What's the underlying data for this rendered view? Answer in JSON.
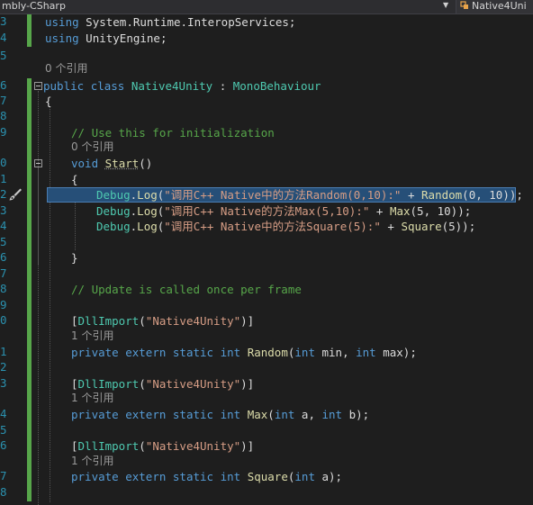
{
  "topbar": {
    "project_label": "mbly-CSharp",
    "class_label": "Native4Uni"
  },
  "line_numbers": [
    "3",
    "4",
    "5",
    "6",
    "7",
    "8",
    "9",
    "0",
    "1",
    "2",
    "3",
    "4",
    "5",
    "6",
    "7",
    "8",
    "9",
    "0",
    "1",
    "2",
    "3",
    "4",
    "5",
    "6",
    "7",
    "8"
  ],
  "code": {
    "using1_kw": "using",
    "using1_ns": " System.Runtime.InteropServices;",
    "using2_kw": "using",
    "using2_ns": " UnityEngine;",
    "lens_class": "0 个引用",
    "class_kw1": "public",
    "class_kw2": "class",
    "class_name": "Native4Unity",
    "class_colon": " : ",
    "class_base": "MonoBehaviour",
    "brace_open": "{",
    "comment_init": "// Use this for initialization",
    "lens_start": "0 个引用",
    "start_kw": "void",
    "start_name": "Start",
    "start_parens": "()",
    "start_brace": "{",
    "log1_obj": "Debug",
    "log1_dot": ".",
    "log1_m": "Log",
    "log1_open": "(",
    "log1_str": "\"调用C++ Native中的方法Random(0,10):\"",
    "log1_plus": " + ",
    "log1_call": "Random",
    "log1_args": "(0, 10));",
    "log2_obj": "Debug",
    "log2_m": "Log",
    "log2_str": "\"调用C++ Native的方法Max(5,10):\"",
    "log2_call": "Max",
    "log2_args": "(5, 10));",
    "log3_obj": "Debug",
    "log3_m": "Log",
    "log3_str": "\"调用C++ Native中的方法Square(5):\"",
    "log3_call": "Square",
    "log3_args": "(5));",
    "start_brace_close": "}",
    "comment_update": "// Update is called once per frame",
    "attr_open": "[",
    "attr_name": "DllImport",
    "attr_str": "\"Native4Unity\"",
    "attr_close": ")]",
    "lens_random": "1 个引用",
    "kw_private": "private",
    "kw_extern": "extern",
    "kw_static": "static",
    "kw_int": "int",
    "random_name": "Random",
    "random_params": "(int min, int max);",
    "lens_max": "1 个引用",
    "max_name": "Max",
    "max_params": "(int a, int b);",
    "lens_square": "1 个引用",
    "square_name": "Square",
    "square_params": "(int a);"
  },
  "colors": {
    "background": "#1e1e1e",
    "keyword": "#569cd6",
    "type": "#4ec9b0",
    "string": "#d69d85",
    "comment": "#57a64a",
    "selection": "#264f78"
  }
}
